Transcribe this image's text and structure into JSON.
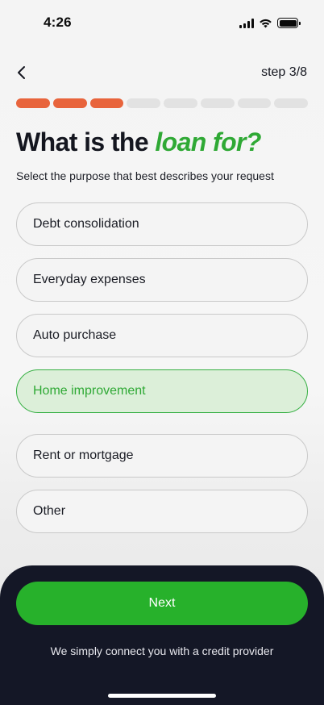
{
  "status_bar": {
    "time": "4:26",
    "icons": [
      "signal-icon",
      "wifi-icon",
      "battery-icon"
    ]
  },
  "header": {
    "back_icon": "chevron-left-icon",
    "step_label": "step 3/8"
  },
  "progress": {
    "current_step": 3,
    "total_steps": 8,
    "done_color": "#e8643c",
    "pending_color": "#e2e2e2"
  },
  "question": {
    "title_plain": "What is the ",
    "title_accent": "loan for?",
    "subtitle": "Select the purpose that best describes your request"
  },
  "options": [
    {
      "label": "Debt consolidation",
      "selected": false
    },
    {
      "label": "Everyday expenses",
      "selected": false
    },
    {
      "label": "Auto purchase",
      "selected": false
    },
    {
      "label": "Home improvement",
      "selected": true
    },
    {
      "label": "Rent or mortgage",
      "selected": false
    },
    {
      "label": "Other",
      "selected": false
    }
  ],
  "footer": {
    "next_label": "Next",
    "note": "We simply connect you with a credit provider"
  },
  "colors": {
    "accent_green": "#2fa935",
    "button_green": "#27b12b",
    "sheet_background": "#141726"
  }
}
